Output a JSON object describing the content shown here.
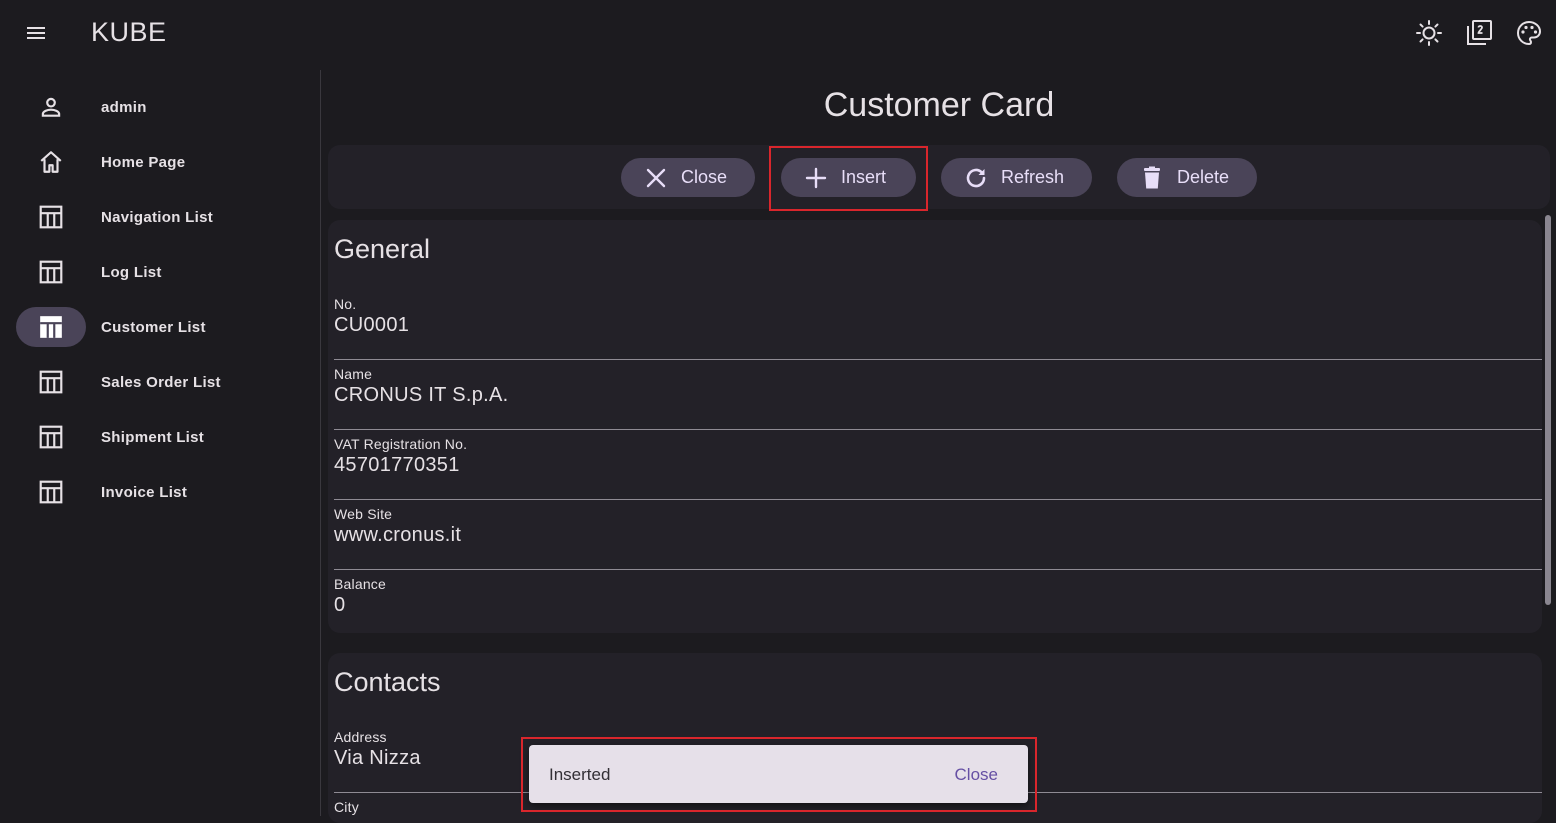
{
  "app": {
    "title": "KUBE"
  },
  "topbar": {
    "icons": [
      "menu-icon",
      "brightness-icon",
      "filter-2-icon",
      "palette-icon"
    ]
  },
  "sidebar": {
    "items": [
      {
        "label": "admin",
        "icon": "person-icon"
      },
      {
        "label": "Home Page",
        "icon": "home-icon"
      },
      {
        "label": "Navigation List",
        "icon": "table-icon"
      },
      {
        "label": "Log List",
        "icon": "table-icon"
      },
      {
        "label": "Customer List",
        "icon": "table-icon",
        "active": true
      },
      {
        "label": "Sales Order List",
        "icon": "table-icon"
      },
      {
        "label": "Shipment List",
        "icon": "table-icon"
      },
      {
        "label": "Invoice List",
        "icon": "table-icon"
      }
    ]
  },
  "page": {
    "title": "Customer Card"
  },
  "toolbar": {
    "close_label": "Close",
    "insert_label": "Insert",
    "refresh_label": "Refresh",
    "delete_label": "Delete"
  },
  "general": {
    "title": "General",
    "fields": [
      {
        "label": "No.",
        "value": "CU0001"
      },
      {
        "label": "Name",
        "value": "CRONUS IT S.p.A."
      },
      {
        "label": "VAT Registration No.",
        "value": "45701770351"
      },
      {
        "label": "Web Site",
        "value": "www.cronus.it"
      },
      {
        "label": "Balance",
        "value": "0"
      }
    ]
  },
  "contacts": {
    "title": "Contacts",
    "fields": [
      {
        "label": "Address",
        "value": "Via Nizza"
      },
      {
        "label": "City",
        "value": ""
      }
    ]
  },
  "snackbar": {
    "message": "Inserted",
    "action_label": "Close"
  },
  "colors": {
    "background": "#1c1b1f",
    "surface": "#232128",
    "button": "#4a4458",
    "highlight": "#d9262c",
    "snackbar": "#e6e0e9",
    "snackbar_action": "#6650a4"
  }
}
